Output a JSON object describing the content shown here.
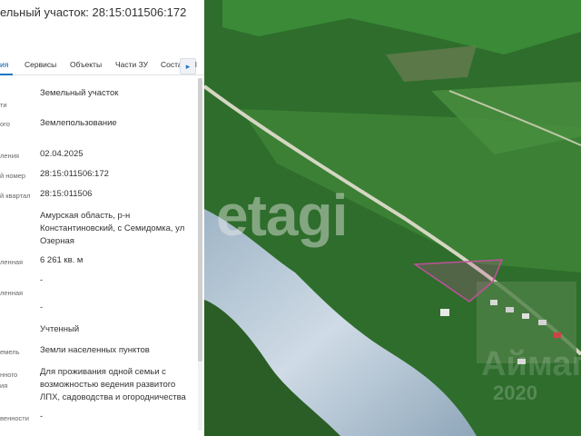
{
  "panel": {
    "title": "ельный участок: 28:15:011506:172",
    "tabs": [
      {
        "label": "ия",
        "active": true
      },
      {
        "label": "Сервисы",
        "active": false
      },
      {
        "label": "Объекты",
        "active": false
      },
      {
        "label": "Части ЗУ",
        "active": false
      },
      {
        "label": "Соста",
        "active": false
      },
      {
        "label": "l",
        "active": false
      }
    ],
    "next_icon": "▸",
    "rows": [
      {
        "label": "ти",
        "value": "Земельный участок"
      },
      {
        "label": "ого",
        "value": "Землепользование"
      },
      {
        "label": "ления",
        "value": "02.04.2025"
      },
      {
        "label": "й номер",
        "value": "28:15:011506:172"
      },
      {
        "label": "й квартал",
        "value": "28:15:011506"
      },
      {
        "label": "",
        "value": "Амурская область, р-н Константиновский, с Семидомка, ул Озерная"
      },
      {
        "label": "ленная",
        "value": "6 261 кв. м"
      },
      {
        "label": "",
        "value": "-"
      },
      {
        "label": "ленная",
        "value": ""
      },
      {
        "label": "",
        "value": "-"
      },
      {
        "label": "",
        "value": "Учтенный"
      },
      {
        "label": "емель",
        "value": "Земли населенных пунктов"
      },
      {
        "label": "нного",
        "value": "Для проживания одной семьи с возможностью ведения развитого ЛПХ, садоводства и огородничества"
      },
      {
        "label": "ия",
        "value": ""
      },
      {
        "label": "венности",
        "value": "-"
      }
    ]
  },
  "map": {
    "watermark": "etagi",
    "watermark_faint": "Аймаги",
    "watermark_year": "2020",
    "colors": {
      "grass": "#2f7a2d",
      "field": "#3d8a3a",
      "water": "#b8c9d8",
      "road": "#d8d8c8",
      "parcel": "#c0509a"
    }
  }
}
